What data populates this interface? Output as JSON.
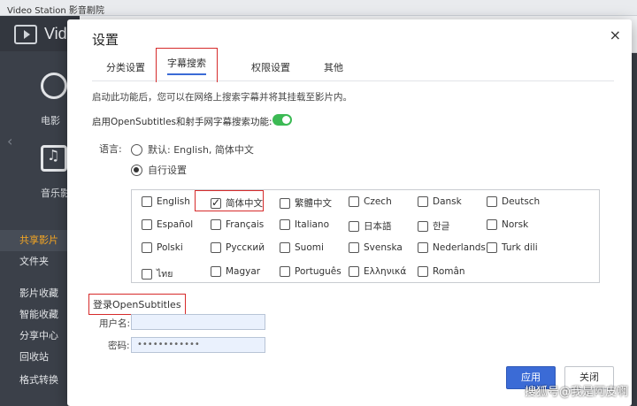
{
  "app": {
    "window_title": "Video Station 影音剧院",
    "brand": "Vid",
    "nav_movie": "电影",
    "nav_music": "音乐影",
    "side_items": [
      "共享影片",
      "文件夹",
      "影片收藏",
      "智能收藏",
      "分享中心",
      "回收站",
      "格式转换"
    ]
  },
  "dialog": {
    "title": "设置",
    "close_icon": "×",
    "tabs": [
      "分类设置",
      "字幕搜索",
      "权限设置",
      "其他"
    ],
    "active_tab": "字幕搜索",
    "description": "启动此功能后，您可以在网络上搜索字幕并将其挂载至影片内。",
    "enable_label": "启用OpenSubtitles和射手网字幕搜索功能:",
    "enable_on": true,
    "language_label": "语言:",
    "radio_default": "默认: English, 简体中文",
    "radio_custom": "自行设置",
    "radio_selected": "custom",
    "languages": [
      {
        "label": "English",
        "checked": false
      },
      {
        "label": "简体中文",
        "checked": true
      },
      {
        "label": "繁體中文",
        "checked": false
      },
      {
        "label": "Czech",
        "checked": false
      },
      {
        "label": "Dansk",
        "checked": false
      },
      {
        "label": "Deutsch",
        "checked": false
      },
      {
        "label": "Español",
        "checked": false
      },
      {
        "label": "Français",
        "checked": false
      },
      {
        "label": "Italiano",
        "checked": false
      },
      {
        "label": "日本語",
        "checked": false
      },
      {
        "label": "한글",
        "checked": false
      },
      {
        "label": "Norsk",
        "checked": false
      },
      {
        "label": "Polski",
        "checked": false
      },
      {
        "label": "Русский",
        "checked": false
      },
      {
        "label": "Suomi",
        "checked": false
      },
      {
        "label": "Svenska",
        "checked": false
      },
      {
        "label": "Nederlands",
        "checked": false
      },
      {
        "label": "Turk dili",
        "checked": false
      },
      {
        "label": "ไทย",
        "checked": false
      },
      {
        "label": "Magyar",
        "checked": false
      },
      {
        "label": "Português",
        "checked": false
      },
      {
        "label": "Ελληνικά",
        "checked": false
      },
      {
        "label": "Român",
        "checked": false
      }
    ],
    "login_title": "登录OpenSubtitles",
    "username_label": "用户名:",
    "username_value": "",
    "password_label": "密码:",
    "password_value": "••••••••••••",
    "apply_label": "应用",
    "cancel_label": "关闭"
  },
  "watermark": "搜狐号@我是阿皮啊"
}
